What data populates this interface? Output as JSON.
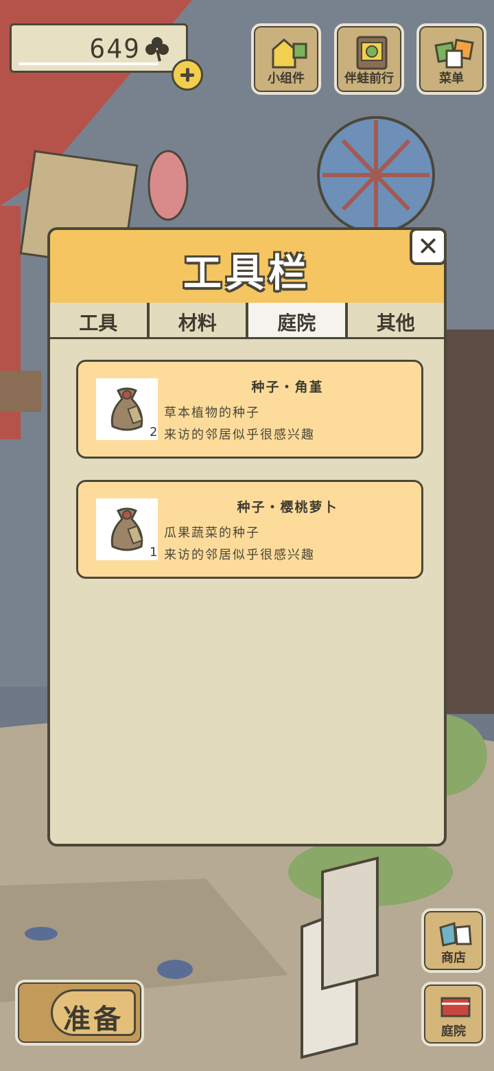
{
  "currency": {
    "count": "649",
    "icon": "clover-icon"
  },
  "top_buttons": [
    {
      "label": "小组件",
      "icon": "widget-icon"
    },
    {
      "label": "伴蛙前行",
      "icon": "frog-journey-icon"
    },
    {
      "label": "菜单",
      "icon": "menu-icon"
    }
  ],
  "dialog": {
    "title": "工具栏",
    "tabs": [
      "工具",
      "材料",
      "庭院",
      "其他"
    ],
    "active_tab": "庭院",
    "items": [
      {
        "name": "种子・角堇",
        "desc_line1": "草本植物的种子",
        "desc_line2": "来访的邻居似乎很感兴趣",
        "count": "2",
        "icon": "seed-bag-icon"
      },
      {
        "name": "种子・樱桃萝卜",
        "desc_line1": "瓜果蔬菜的种子",
        "desc_line2": "来访的邻居似乎很感兴趣",
        "count": "1",
        "icon": "seed-bag-icon"
      }
    ],
    "close_label": "✕"
  },
  "bottom": {
    "prepare_label": "准备",
    "shop_label": "商店",
    "yard_label": "庭院"
  },
  "colors": {
    "header": "#f4c561",
    "card": "#fddc9b",
    "panel": "#e3dbbd",
    "outline": "#4b4738"
  }
}
